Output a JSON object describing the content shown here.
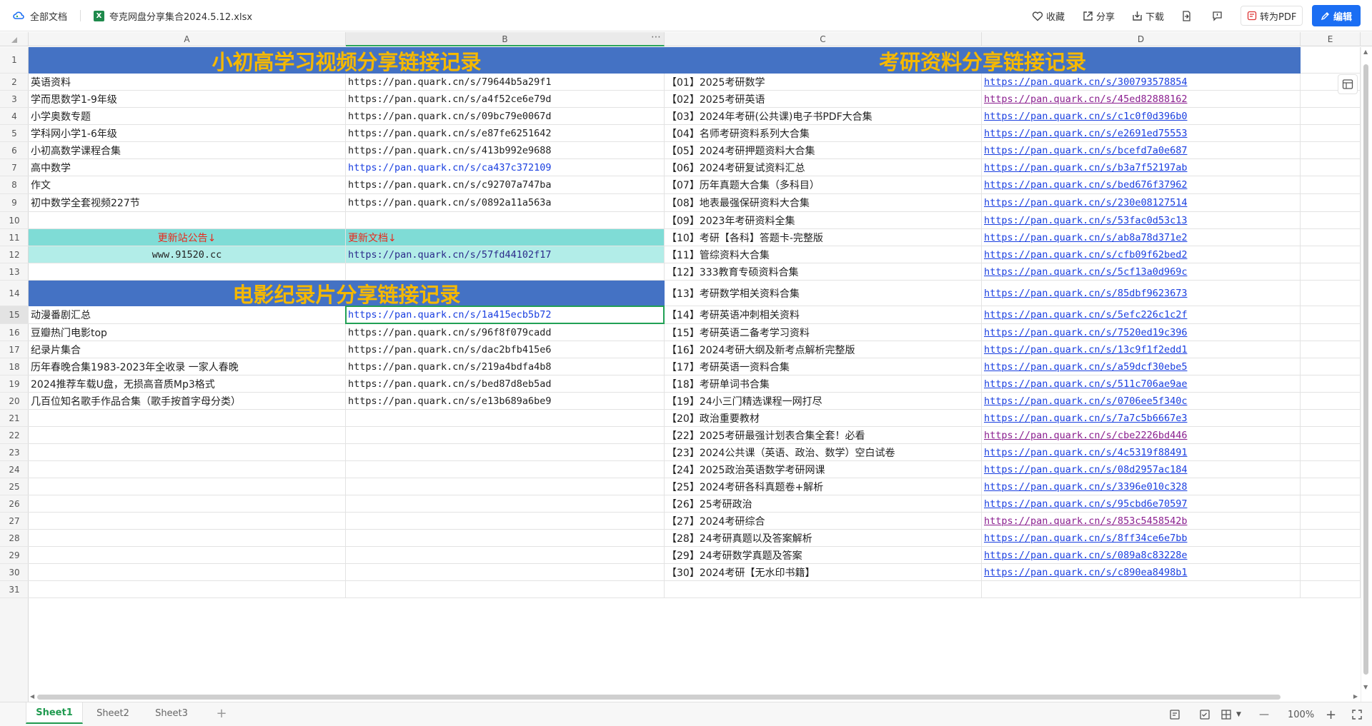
{
  "topbar": {
    "breadcrumb_root": "全部文档",
    "file_icon_letter": "X",
    "file_name": "夸克网盘分享集合2024.5.12.xlsx",
    "collect_label": "收藏",
    "share_label": "分享",
    "download_label": "下载",
    "to_pdf_label": "转为PDF",
    "edit_label": "编辑"
  },
  "columns": [
    "A",
    "B",
    "C",
    "D",
    "E"
  ],
  "rows": [
    "1",
    "2",
    "3",
    "4",
    "5",
    "6",
    "7",
    "8",
    "9",
    "10",
    "11",
    "12",
    "13",
    "14",
    "15",
    "16",
    "17",
    "18",
    "19",
    "20",
    "21",
    "22",
    "23",
    "24",
    "25",
    "26",
    "27",
    "28",
    "29",
    "30",
    "31"
  ],
  "selected_row": "15",
  "sheet": {
    "title_left": "小初高学习视频分享链接记录",
    "title_right": "考研资料分享链接记录",
    "title_movies": "电影纪录片分享链接记录",
    "study_items": [
      {
        "name": "英语资料",
        "url": "https://pan.quark.cn/s/79644b5a29f1"
      },
      {
        "name": "学而思数学1-9年级",
        "url": "https://pan.quark.cn/s/a4f52ce6e79d"
      },
      {
        "name": "小学奥数专题",
        "url": "https://pan.quark.cn/s/09bc79e0067d"
      },
      {
        "name": "学科网小学1-6年级",
        "url": "https://pan.quark.cn/s/e87fe6251642"
      },
      {
        "name": "小初高数学课程合集",
        "url": "https://pan.quark.cn/s/413b992e9688"
      },
      {
        "name": "高中数学",
        "url": "https://pan.quark.cn/s/ca437c372109"
      },
      {
        "name": "作文",
        "url": "https://pan.quark.cn/s/c92707a747ba"
      },
      {
        "name": "初中数学全套视频227节",
        "url": "https://pan.quark.cn/s/0892a11a563a"
      }
    ],
    "notice_label": "更新站公告↓",
    "notice_site": "www.91520.cc",
    "doc_label": "更新文档↓",
    "doc_url": "https://pan.quark.cn/s/57fd44102f17",
    "movie_items": [
      {
        "name": "动漫番剧汇总",
        "url": "https://pan.quark.cn/s/1a415ecb5b72"
      },
      {
        "name": "豆瓣热门电影top",
        "url": "https://pan.quark.cn/s/96f8f079cadd"
      },
      {
        "name": "纪录片集合",
        "url": "https://pan.quark.cn/s/dac2bfb415e6"
      },
      {
        "name": "历年春晚合集1983-2023年全收录 一家人春晚",
        "url": "https://pan.quark.cn/s/219a4bdfa4b8"
      },
      {
        "name": "2024推荐车载U盘，无损高音质Mp3格式",
        "url": "https://pan.quark.cn/s/bed87d8eb5ad"
      },
      {
        "name": "几百位知名歌手作品合集（歌手按首字母分类）",
        "url": "https://pan.quark.cn/s/e13b689a6be9"
      }
    ],
    "kaoyan_items": [
      {
        "name": "【01】2025考研数学",
        "url": "https://pan.quark.cn/s/300793578854"
      },
      {
        "name": "【02】2025考研英语",
        "url": "https://pan.quark.cn/s/45ed82888162"
      },
      {
        "name": "【03】2024年考研(公共课)电子书PDF大合集",
        "url": "https://pan.quark.cn/s/c1c0f0d396b0"
      },
      {
        "name": "【04】名师考研资料系列大合集",
        "url": "https://pan.quark.cn/s/e2691ed75553"
      },
      {
        "name": "【05】2024考研押题资料大合集",
        "url": "https://pan.quark.cn/s/bcefd7a0e687"
      },
      {
        "name": "【06】2024考研复试资料汇总",
        "url": "https://pan.quark.cn/s/b3a7f52197ab"
      },
      {
        "name": "【07】历年真题大合集（多科目）",
        "url": "https://pan.quark.cn/s/bed676f37962"
      },
      {
        "name": "【08】地表最强保研资料大合集",
        "url": "https://pan.quark.cn/s/230e08127514"
      },
      {
        "name": "【09】2023年考研资料全集",
        "url": "https://pan.quark.cn/s/53fac0d53c13"
      },
      {
        "name": "【10】考研【各科】答题卡-完整版",
        "url": "https://pan.quark.cn/s/ab8a78d371e2"
      },
      {
        "name": "【11】管综资料大合集",
        "url": "https://pan.quark.cn/s/cfb09f62bed2"
      },
      {
        "name": "【12】333教育专硕资料合集",
        "url": "https://pan.quark.cn/s/5cf13a0d969c"
      },
      {
        "name": "【13】考研数学相关资料合集",
        "url": "https://pan.quark.cn/s/85dbf9623673"
      },
      {
        "name": "【14】考研英语冲刺相关资料",
        "url": "https://pan.quark.cn/s/5efc226c1c2f"
      },
      {
        "name": "【15】考研英语二备考学习资料",
        "url": "https://pan.quark.cn/s/7520ed19c396"
      },
      {
        "name": "【16】2024考研大纲及新考点解析完整版",
        "url": "https://pan.quark.cn/s/13c9f1f2edd1"
      },
      {
        "name": "【17】考研英语一资料合集",
        "url": "https://pan.quark.cn/s/a59dcf30ebe5"
      },
      {
        "name": "【18】考研单词书合集",
        "url": "https://pan.quark.cn/s/511c706ae9ae"
      },
      {
        "name": "【19】24小三门精选课程一网打尽",
        "url": "https://pan.quark.cn/s/0706ee5f340c"
      },
      {
        "name": "【20】政治重要教材",
        "url": "https://pan.quark.cn/s/7a7c5b6667e3"
      },
      {
        "name": "【22】2025考研最强计划表合集全套！必看",
        "url": "https://pan.quark.cn/s/cbe2226bd446"
      },
      {
        "name": "【23】2024公共课（英语、政治、数学）空白试卷",
        "url": "https://pan.quark.cn/s/4c5319f88491"
      },
      {
        "name": "【24】2025政治英语数学考研网课",
        "url": "https://pan.quark.cn/s/08d2957ac184"
      },
      {
        "name": "【25】2024考研各科真题卷+解析",
        "url": "https://pan.quark.cn/s/3396e010c328"
      },
      {
        "name": "【26】25考研政治",
        "url": "https://pan.quark.cn/s/95cbd6e70597"
      },
      {
        "name": "【27】2024考研综合",
        "url": "https://pan.quark.cn/s/853c5458542b"
      },
      {
        "name": "【28】24考研真题以及答案解析",
        "url": "https://pan.quark.cn/s/8ff34ce6e7bb"
      },
      {
        "name": "【29】24考研数学真题及答案",
        "url": "https://pan.quark.cn/s/089a8c83228e"
      },
      {
        "name": "【30】2024考研【无水印书籍】",
        "url": "https://pan.quark.cn/s/c890ea8498b1"
      }
    ]
  },
  "colors": {
    "title_bg": "#4472c4",
    "title_text": "#f5b800",
    "teal": "#7fdcd6",
    "link": "#1a3fe0",
    "visited": "#8a1e8f",
    "accent_green": "#1f9a4f"
  },
  "bottom": {
    "tabs": [
      "Sheet1",
      "Sheet2",
      "Sheet3"
    ],
    "add_tab": "+",
    "zoom": "100%",
    "zoom_minus": "—",
    "zoom_plus": "+"
  }
}
